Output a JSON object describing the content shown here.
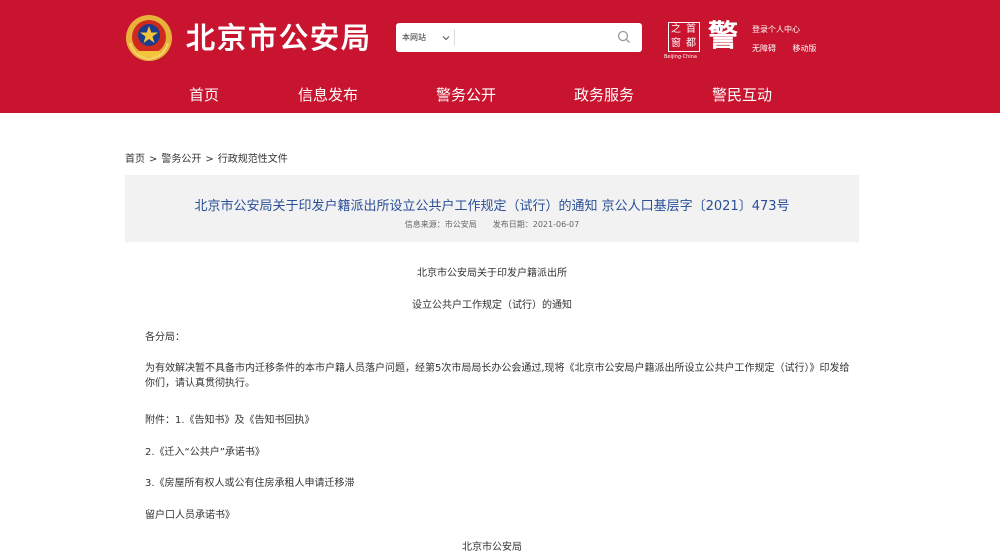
{
  "header": {
    "site_title": "北京市公安局",
    "search": {
      "scope": "本网站",
      "placeholder": ""
    },
    "logo_stamp_chars": [
      "之",
      "首",
      "窗",
      "都"
    ],
    "logo_stamp_sub": "Beijing·China",
    "logo_police_char": "警",
    "top_links": {
      "login": "登录个人中心",
      "accessible": "无障碍",
      "mobile": "移动版"
    }
  },
  "nav": {
    "items": [
      {
        "label": "首页"
      },
      {
        "label": "信息发布"
      },
      {
        "label": "警务公开"
      },
      {
        "label": "政务服务"
      },
      {
        "label": "警民互动"
      }
    ]
  },
  "breadcrumb": {
    "items": [
      "首页",
      "警务公开",
      "行政规范性文件"
    ],
    "separator": ">"
  },
  "article": {
    "title": "北京市公安局关于印发户籍派出所设立公共户工作规定（试行）的通知 京公人口基层字〔2021〕473号",
    "source": "信息来源：市公安局",
    "date": "发布日期：2021-06-07",
    "paragraphs": {
      "heading1": "北京市公安局关于印发户籍派出所",
      "heading2": "设立公共户工作规定（试行）的通知",
      "salutation": "各分局：",
      "body": "为有效解决暂不具备市内迁移条件的本市户籍人员落户问题，经第5次市局局长办公会通过,现将《北京市公安局户籍派出所设立公共户工作规定（试行）》印发给你们，请认真贯彻执行。",
      "attach1": "附件：1.《告知书》及《告知书回执》",
      "attach2": "2.《迁入“公共户”承诺书》",
      "attach3": "3.《房屋所有权人或公有住房承租人申请迁移滞",
      "attach3b": "留户口人员承诺书》",
      "signature": "北京市公安局"
    }
  },
  "colors": {
    "brand_red": "#c8142e",
    "title_blue": "#2a4f97",
    "title_box_bg": "#f2f2f2"
  }
}
